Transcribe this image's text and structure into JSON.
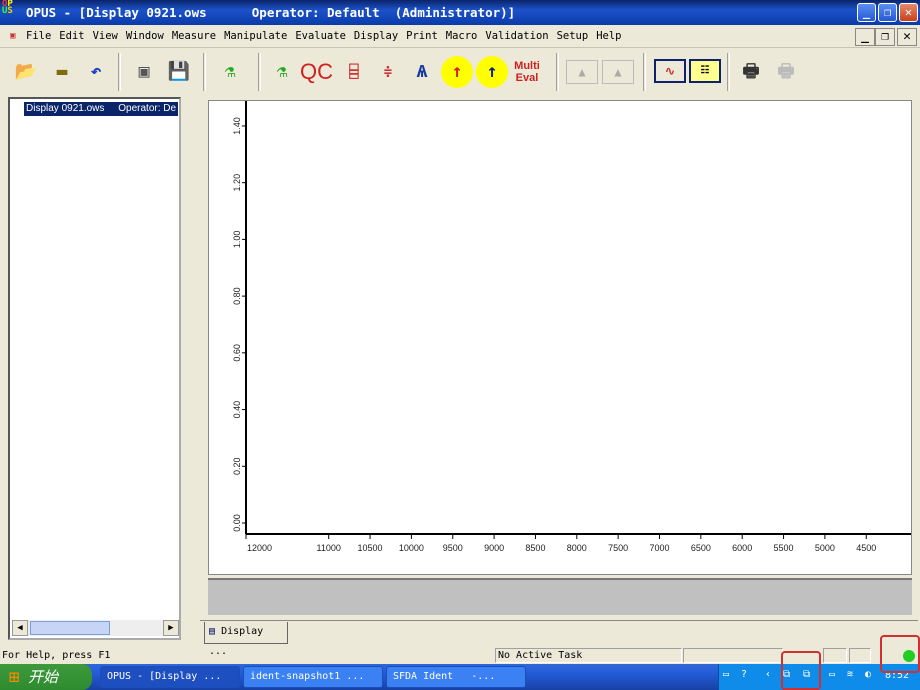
{
  "window": {
    "title": "OPUS - [Display 0921.ows      Operator: Default  (Administrator)]",
    "minimize": "_",
    "restore": "❐",
    "close": "✕"
  },
  "menu": {
    "items": [
      "File",
      "Edit",
      "View",
      "Window",
      "Measure",
      "Manipulate",
      "Evaluate",
      "Display",
      "Print",
      "Macro",
      "Validation",
      "Setup",
      "Help"
    ],
    "mdi_minimize": "_",
    "mdi_restore": "❐",
    "mdi_close": "✕"
  },
  "toolbar": {
    "qc_label": "QC",
    "multi_eval_line1": "Multi",
    "multi_eval_line2": "Eval"
  },
  "tree": {
    "item": "Display 0921.ows     Operator: De"
  },
  "tab": {
    "label": "Display ..."
  },
  "status": {
    "help": "For Help, press F1",
    "task": "No Active Task"
  },
  "taskbar": {
    "start": "开始",
    "tasks": [
      "OPUS - [Display ...",
      "ident-snapshot1 ...",
      "SFDA Ident   -..."
    ],
    "clock": "8:52"
  },
  "colors": {
    "titlebar": "#0a246a",
    "highlight_box": "#d03030",
    "status_light": "#22cc22"
  },
  "chart_data": {
    "type": "line",
    "series": [],
    "x_ticks": [
      "12000",
      "11000",
      "10500",
      "10000",
      "9500",
      "9000",
      "8500",
      "8000",
      "7500",
      "7000",
      "6500",
      "6000",
      "5500",
      "5000",
      "4500"
    ],
    "y_ticks": [
      "0.00",
      "0.20",
      "0.40",
      "0.60",
      "0.80",
      "1.00",
      "1.20",
      "1.40"
    ],
    "xlim": [
      12000,
      4000
    ],
    "ylim": [
      0,
      1.5
    ],
    "xlabel": "",
    "ylabel": "",
    "grid": false
  }
}
